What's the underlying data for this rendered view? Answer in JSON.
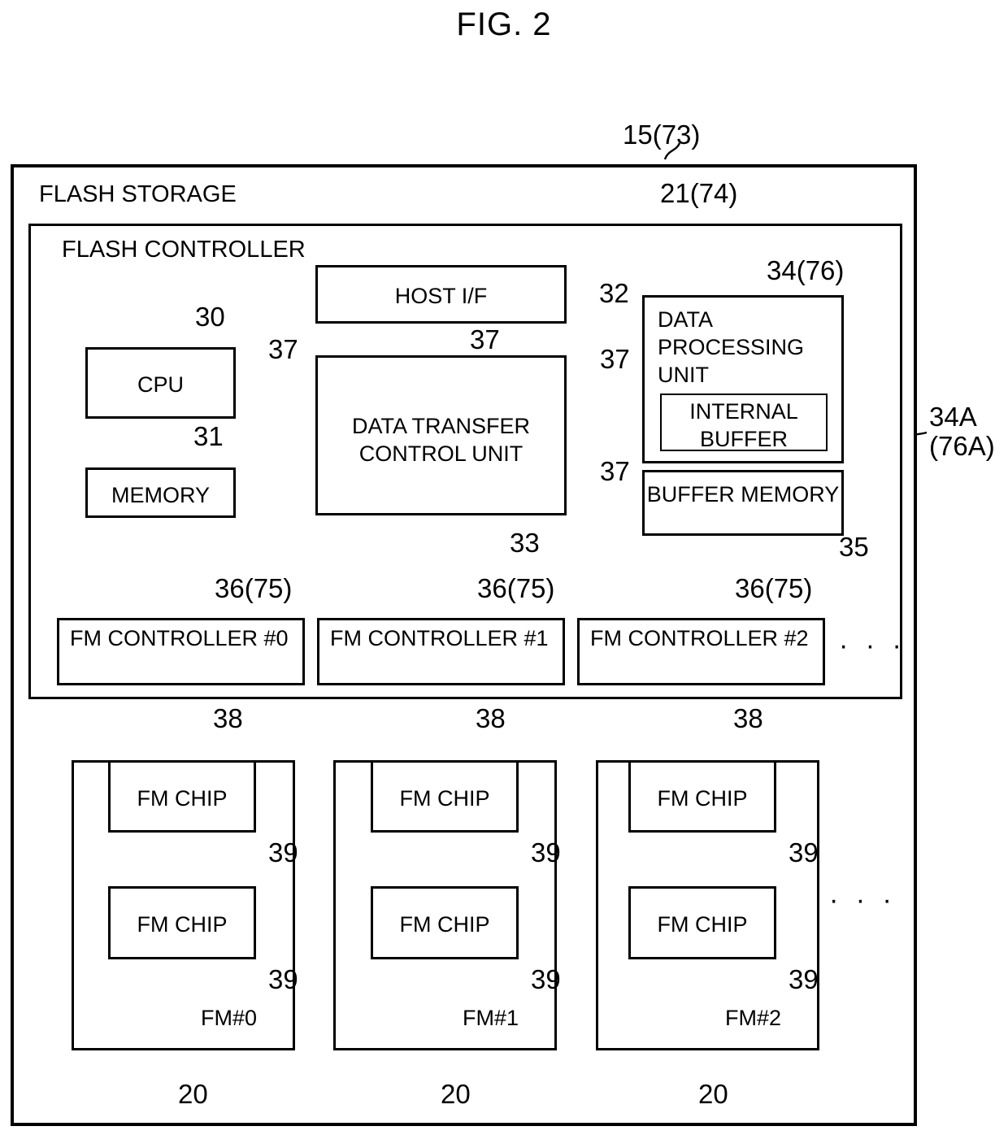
{
  "figure": {
    "title": "FIG. 2"
  },
  "outer": {
    "title": "FLASH STORAGE",
    "ref": "15(73)"
  },
  "controller": {
    "title": "FLASH CONTROLLER",
    "ref": "21(74)"
  },
  "blocks": {
    "cpu": {
      "label": "CPU",
      "ref": "30"
    },
    "memory": {
      "label": "MEMORY",
      "ref": "31"
    },
    "host_if": {
      "label": "HOST I/F",
      "ref": "32"
    },
    "data_transfer": {
      "label": "DATA TRANSFER\nCONTROL UNIT",
      "ref": "33"
    },
    "data_processing": {
      "label": "DATA\nPROCESSING\nUNIT",
      "ref": "34(76)"
    },
    "internal_buffer": {
      "label": "INTERNAL\nBUFFER",
      "ref": "34A\n(76A)"
    },
    "buffer_memory": {
      "label": "BUFFER\nMEMORY",
      "ref": "35"
    }
  },
  "bus_refs": {
    "cpu_to_dtcu": "37",
    "hostif_to_dtcu": "37",
    "dtcu_to_dpu": "37",
    "dtcu_to_bufmem": "37"
  },
  "fm_controllers": [
    {
      "label": "FM CONTROLLER\n#0",
      "ref": "36(75)",
      "link_ref": "38"
    },
    {
      "label": "FM CONTROLLER\n#1",
      "ref": "36(75)",
      "link_ref": "38"
    },
    {
      "label": "FM CONTROLLER\n#2",
      "ref": "36(75)",
      "link_ref": "38"
    }
  ],
  "fm_controllers_ellipsis": "· · ·",
  "fm_modules": [
    {
      "group_label": "FM#0",
      "group_ref": "20",
      "chips": [
        {
          "label": "FM CHIP",
          "ref": "39"
        },
        {
          "label": "FM CHIP",
          "ref": "39"
        }
      ]
    },
    {
      "group_label": "FM#1",
      "group_ref": "20",
      "chips": [
        {
          "label": "FM CHIP",
          "ref": "39"
        },
        {
          "label": "FM CHIP",
          "ref": "39"
        }
      ]
    },
    {
      "group_label": "FM#2",
      "group_ref": "20",
      "chips": [
        {
          "label": "FM CHIP",
          "ref": "39"
        },
        {
          "label": "FM CHIP",
          "ref": "39"
        }
      ]
    }
  ],
  "fm_modules_ellipsis": "· · ·",
  "colors": {
    "line": "#000000",
    "background": "#ffffff"
  }
}
